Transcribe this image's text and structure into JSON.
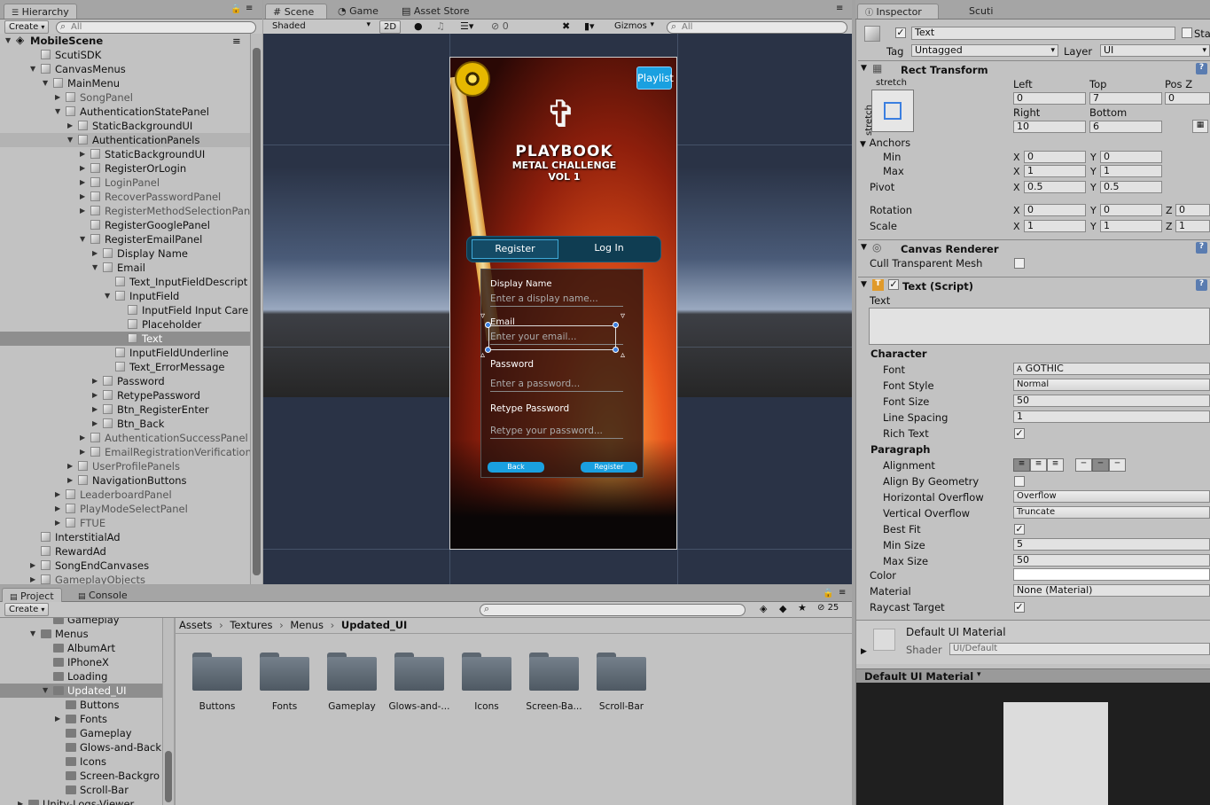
{
  "hierarchy": {
    "tab": "Hierarchy",
    "create": "Create",
    "search": "All",
    "rows": [
      {
        "label": "MobileScene",
        "indent": 0,
        "arrow": "down",
        "icon": "unity",
        "bold": true
      },
      {
        "label": "ScutiSDK",
        "indent": 2,
        "arrow": "",
        "icon": "cube"
      },
      {
        "label": "CanvasMenus",
        "indent": 2,
        "arrow": "down",
        "icon": "cube"
      },
      {
        "label": "MainMenu",
        "indent": 3,
        "arrow": "down",
        "icon": "cube"
      },
      {
        "label": "SongPanel",
        "indent": 4,
        "arrow": "right",
        "icon": "cube",
        "dim": true
      },
      {
        "label": "AuthenticationStatePanel",
        "indent": 4,
        "arrow": "down",
        "icon": "cube"
      },
      {
        "label": "StaticBackgroundUI",
        "indent": 5,
        "arrow": "right",
        "icon": "cube"
      },
      {
        "label": "AuthenticationPanels",
        "indent": 5,
        "arrow": "down",
        "icon": "cube",
        "sel2": true
      },
      {
        "label": "StaticBackgroundUI",
        "indent": 6,
        "arrow": "right",
        "icon": "cube"
      },
      {
        "label": "RegisterOrLogin",
        "indent": 6,
        "arrow": "right",
        "icon": "cube"
      },
      {
        "label": "LoginPanel",
        "indent": 6,
        "arrow": "right",
        "icon": "cube",
        "dim": true
      },
      {
        "label": "RecoverPasswordPanel",
        "indent": 6,
        "arrow": "right",
        "icon": "cube",
        "dim": true
      },
      {
        "label": "RegisterMethodSelectionPan",
        "indent": 6,
        "arrow": "right",
        "icon": "cube",
        "dim": true
      },
      {
        "label": "RegisterGooglePanel",
        "indent": 6,
        "arrow": "",
        "icon": "cube"
      },
      {
        "label": "RegisterEmailPanel",
        "indent": 6,
        "arrow": "down",
        "icon": "cube"
      },
      {
        "label": "Display Name",
        "indent": 7,
        "arrow": "right",
        "icon": "cube"
      },
      {
        "label": "Email",
        "indent": 7,
        "arrow": "down",
        "icon": "cube"
      },
      {
        "label": "Text_InputFieldDescript",
        "indent": 8,
        "arrow": "",
        "icon": "cube"
      },
      {
        "label": "InputField",
        "indent": 8,
        "arrow": "down",
        "icon": "cube"
      },
      {
        "label": "InputField Input Care",
        "indent": 9,
        "arrow": "",
        "icon": "cube"
      },
      {
        "label": "Placeholder",
        "indent": 9,
        "arrow": "",
        "icon": "cube"
      },
      {
        "label": "Text",
        "indent": 9,
        "arrow": "",
        "icon": "cube",
        "selected": true
      },
      {
        "label": "InputFieldUnderline",
        "indent": 8,
        "arrow": "",
        "icon": "cube"
      },
      {
        "label": "Text_ErrorMessage",
        "indent": 8,
        "arrow": "",
        "icon": "cube"
      },
      {
        "label": "Password",
        "indent": 7,
        "arrow": "right",
        "icon": "cube"
      },
      {
        "label": "RetypePassword",
        "indent": 7,
        "arrow": "right",
        "icon": "cube"
      },
      {
        "label": "Btn_RegisterEnter",
        "indent": 7,
        "arrow": "right",
        "icon": "cube"
      },
      {
        "label": "Btn_Back",
        "indent": 7,
        "arrow": "right",
        "icon": "cube"
      },
      {
        "label": "AuthenticationSuccessPanel",
        "indent": 6,
        "arrow": "right",
        "icon": "cube",
        "dim": true
      },
      {
        "label": "EmailRegistrationVerification",
        "indent": 6,
        "arrow": "right",
        "icon": "cube",
        "dim": true
      },
      {
        "label": "UserProfilePanels",
        "indent": 5,
        "arrow": "right",
        "icon": "cube",
        "dim": true
      },
      {
        "label": "NavigationButtons",
        "indent": 5,
        "arrow": "right",
        "icon": "cube"
      },
      {
        "label": "LeaderboardPanel",
        "indent": 4,
        "arrow": "right",
        "icon": "cube",
        "dim": true
      },
      {
        "label": "PlayModeSelectPanel",
        "indent": 4,
        "arrow": "right",
        "icon": "cube",
        "dim": true
      },
      {
        "label": "FTUE",
        "indent": 4,
        "arrow": "right",
        "icon": "cube",
        "dim": true
      },
      {
        "label": "InterstitialAd",
        "indent": 2,
        "arrow": "",
        "icon": "cube"
      },
      {
        "label": "RewardAd",
        "indent": 2,
        "arrow": "",
        "icon": "cube"
      },
      {
        "label": "SongEndCanvases",
        "indent": 2,
        "arrow": "right",
        "icon": "cube"
      },
      {
        "label": "GameplayObjects",
        "indent": 2,
        "arrow": "right",
        "icon": "cube",
        "dim": true
      }
    ]
  },
  "scene": {
    "tabs": [
      "Scene",
      "Game",
      "Asset Store"
    ],
    "shading": "Shaded",
    "mode2d": "2D",
    "fx_count": "0",
    "gizmos": "Gizmos",
    "search": "All"
  },
  "game": {
    "playlist": "Playlist",
    "logo_line1": "PLAYBOOK",
    "logo_line2": "METAL CHALLENGE",
    "logo_line3": "VOL 1",
    "tab_register": "Register",
    "tab_login": "Log In",
    "display_name_label": "Display Name",
    "display_name_placeholder": "Enter a display name...",
    "email_label": "Email",
    "email_placeholder": "Enter your email...",
    "password_label": "Password",
    "password_placeholder": "Enter a password...",
    "retype_label": "Retype Password",
    "retype_placeholder": "Retype your password...",
    "back_button": "Back",
    "register_button": "Register"
  },
  "inspector": {
    "tabs": [
      "Inspector",
      "Scuti"
    ],
    "object_name": "Text",
    "static_label": "Sta",
    "tag_label": "Tag",
    "tag_value": "Untagged",
    "layer_label": "Layer",
    "layer_value": "UI",
    "rect_transform": {
      "title": "Rect Transform",
      "stretch_top": "stretch",
      "stretch_side": "stretch",
      "left_label": "Left",
      "left": "0",
      "top_label": "Top",
      "top": "7",
      "posz_label": "Pos Z",
      "posz": "0",
      "right_label": "Right",
      "right": "10",
      "bottom_label": "Bottom",
      "bottom": "6",
      "anchors_label": "Anchors",
      "min_label": "Min",
      "min_x": "0",
      "min_y": "0",
      "max_label": "Max",
      "max_x": "1",
      "max_y": "1",
      "pivot_label": "Pivot",
      "pivot_x": "0.5",
      "pivot_y": "0.5",
      "rotation_label": "Rotation",
      "rot_x": "0",
      "rot_y": "0",
      "rot_z": "0",
      "scale_label": "Scale",
      "scale_x": "1",
      "scale_y": "1",
      "scale_z": "1"
    },
    "canvas_renderer": {
      "title": "Canvas Renderer",
      "cull_label": "Cull Transparent Mesh"
    },
    "text_script": {
      "title": "Text (Script)",
      "text_label": "Text",
      "character_label": "Character",
      "font_label": "Font",
      "font_value": "GOTHIC",
      "font_style_label": "Font Style",
      "font_style_value": "Normal",
      "font_size_label": "Font Size",
      "font_size_value": "50",
      "line_spacing_label": "Line Spacing",
      "line_spacing_value": "1",
      "rich_text_label": "Rich Text",
      "paragraph_label": "Paragraph",
      "alignment_label": "Alignment",
      "align_geom_label": "Align By Geometry",
      "hoverflow_label": "Horizontal Overflow",
      "hoverflow_value": "Overflow",
      "voverflow_label": "Vertical Overflow",
      "voverflow_value": "Truncate",
      "bestfit_label": "Best Fit",
      "minsize_label": "Min Size",
      "minsize_value": "5",
      "maxsize_label": "Max Size",
      "maxsize_value": "50",
      "color_label": "Color",
      "material_label": "Material",
      "material_value": "None (Material)",
      "raycast_label": "Raycast Target"
    },
    "material": {
      "name": "Default UI Material",
      "shader_label": "Shader",
      "shader_value": "UI/Default",
      "preview_title": "Default UI Material"
    }
  },
  "project": {
    "tabs": [
      "Project",
      "Console"
    ],
    "create": "Create",
    "count": "25",
    "breadcrumb": [
      "Assets",
      "Textures",
      "Menus",
      "Updated_UI"
    ],
    "tree": [
      {
        "label": "Gameplay",
        "indent": 3,
        "arrow": ""
      },
      {
        "label": "Menus",
        "indent": 2,
        "arrow": "down"
      },
      {
        "label": "AlbumArt",
        "indent": 3,
        "arrow": ""
      },
      {
        "label": "IPhoneX",
        "indent": 3,
        "arrow": ""
      },
      {
        "label": "Loading",
        "indent": 3,
        "arrow": ""
      },
      {
        "label": "Updated_UI",
        "indent": 3,
        "arrow": "down",
        "selected": true
      },
      {
        "label": "Buttons",
        "indent": 4,
        "arrow": ""
      },
      {
        "label": "Fonts",
        "indent": 4,
        "arrow": "right"
      },
      {
        "label": "Gameplay",
        "indent": 4,
        "arrow": ""
      },
      {
        "label": "Glows-and-Back",
        "indent": 4,
        "arrow": ""
      },
      {
        "label": "Icons",
        "indent": 4,
        "arrow": ""
      },
      {
        "label": "Screen-Backgro",
        "indent": 4,
        "arrow": ""
      },
      {
        "label": "Scroll-Bar",
        "indent": 4,
        "arrow": ""
      },
      {
        "label": "Unity-Logs-Viewer",
        "indent": 1,
        "arrow": "right"
      }
    ],
    "folders": [
      "Buttons",
      "Fonts",
      "Gameplay",
      "Glows-and-...",
      "Icons",
      "Screen-Ba...",
      "Scroll-Bar"
    ]
  }
}
